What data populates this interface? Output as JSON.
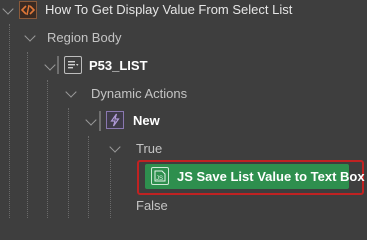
{
  "tree": {
    "page": {
      "label": "How To Get Display Value From Select List",
      "icon": "code-brackets-icon"
    },
    "region": {
      "label": "Region Body"
    },
    "item": {
      "label": "P53_LIST",
      "icon": "select-list-icon"
    },
    "dynamic_actions": {
      "label": "Dynamic Actions"
    },
    "event": {
      "label": "New",
      "icon": "lightning-icon"
    },
    "true_branch": {
      "label": "True"
    },
    "action": {
      "label": "JS Save List Value to Text Box",
      "icon": "javascript-file-icon",
      "selected": true
    },
    "false_branch": {
      "label": "False"
    }
  },
  "colors": {
    "background": "#3e3e3e",
    "page_icon": "#d2641e",
    "selected_action_bg": "#2e8f4e",
    "selection_outline": "#c02222",
    "event_icon": "#9b7fcc"
  }
}
